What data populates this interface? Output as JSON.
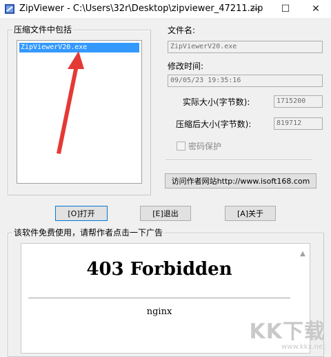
{
  "window": {
    "title": "ZipViewer - C:\\Users\\32r\\Desktop\\zipviewer_47211.zip",
    "icon": "zip-archive-icon",
    "controls": {
      "minimize": "—",
      "maximize": "☐",
      "close": "✕"
    }
  },
  "contents_group": {
    "label": "压缩文件中包括",
    "files": [
      {
        "name": "ZipViewerV20.exe",
        "selected": true
      }
    ]
  },
  "details": {
    "filename_label": "文件名:",
    "filename_value": "ZipViewerV20.exe",
    "modified_label": "修改时间:",
    "modified_value": "09/05/23 19:35:16",
    "size_label": "实际大小(字节数):",
    "size_value": "1715200",
    "compressed_label": "压缩后大小(字节数):",
    "compressed_value": "819712",
    "password_label": "密码保护",
    "password_checked": false,
    "author_site_button": "访问作者网站http://www.isoft168.com"
  },
  "actions": {
    "open": "[O]打开",
    "exit": "[E]退出",
    "about": "[A]关于"
  },
  "ad_group": {
    "label": "该软件免费使用，请帮作者点击一下广告",
    "page_title": "403 Forbidden",
    "page_server": "nginx"
  },
  "watermark": {
    "brand": "KK下载",
    "url": "www.kkx.net"
  },
  "colors": {
    "selection": "#3399ff",
    "annotation_arrow": "#e53935",
    "window_bg": "#f0f0f0"
  }
}
